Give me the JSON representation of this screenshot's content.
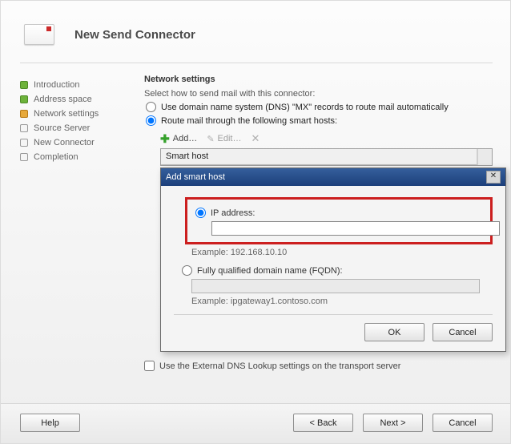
{
  "header": {
    "title": "New Send Connector"
  },
  "steps": [
    {
      "label": "Introduction",
      "state": "done"
    },
    {
      "label": "Address space",
      "state": "done"
    },
    {
      "label": "Network settings",
      "state": "current"
    },
    {
      "label": "Source Server",
      "state": "pending"
    },
    {
      "label": "New Connector",
      "state": "pending"
    },
    {
      "label": "Completion",
      "state": "pending"
    }
  ],
  "content": {
    "section_title": "Network settings",
    "instruction": "Select how to send mail with this connector:",
    "opt_dns": "Use domain name system (DNS) \"MX\" records to route mail automatically",
    "opt_smart": "Route mail through the following smart hosts:",
    "routing_selected": "smart",
    "toolbar": {
      "add": "Add…",
      "edit": "Edit…"
    },
    "grid_header": "Smart host",
    "external_dns": "Use the External DNS Lookup settings on the transport server",
    "external_dns_checked": false
  },
  "dialog": {
    "title": "Add smart host",
    "opt_ip": "IP address:",
    "opt_fqdn": "Fully qualified domain name (FQDN):",
    "selected": "ip",
    "ip_value": "",
    "ip_example": "Example: 192.168.10.10",
    "fqdn_value": "",
    "fqdn_example": "Example: ipgateway1.contoso.com",
    "ok": "OK",
    "cancel": "Cancel"
  },
  "footer": {
    "help": "Help",
    "back": "< Back",
    "next": "Next >",
    "cancel": "Cancel"
  }
}
